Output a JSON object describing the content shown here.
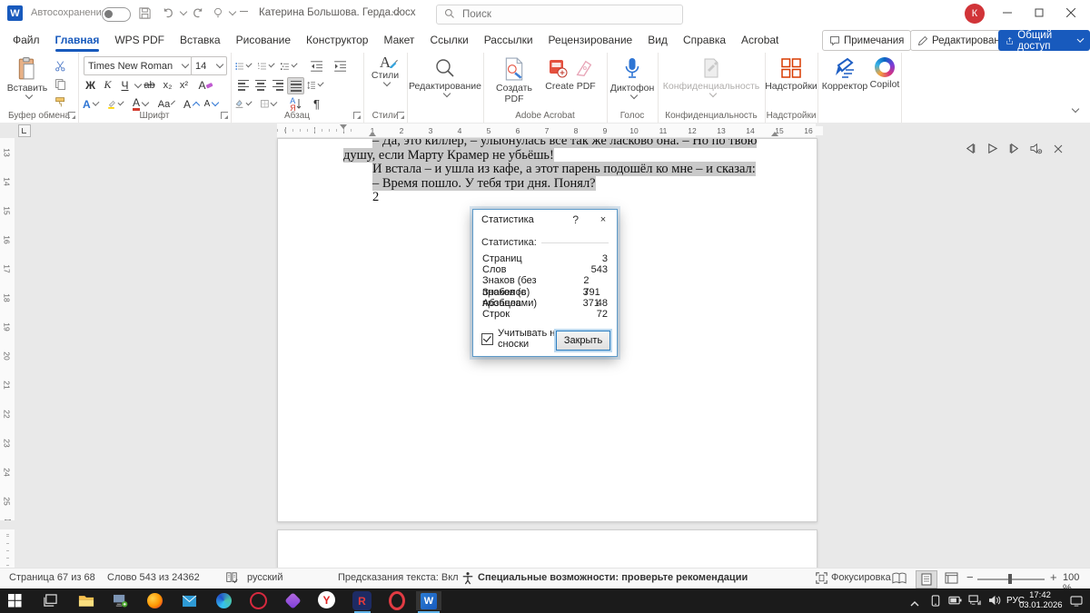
{
  "titlebar": {
    "app_logo": "W",
    "autosave_label": "Автосохранение",
    "doc_title": "Катерина Большова. Герда.docx",
    "search_placeholder": "Поиск",
    "avatar_initial": "К"
  },
  "tabs": [
    "Файл",
    "Главная",
    "WPS PDF",
    "Вставка",
    "Рисование",
    "Конструктор",
    "Макет",
    "Ссылки",
    "Рассылки",
    "Рецензирование",
    "Вид",
    "Справка",
    "Acrobat"
  ],
  "header_actions": {
    "comments": "Примечания",
    "editing": "Редактирование",
    "share": "Общий доступ"
  },
  "ribbon": {
    "clipboard": {
      "paste": "Вставить",
      "group": "Буфер обмена"
    },
    "font": {
      "name": "Times New Roman",
      "size": "14",
      "bold": "Ж",
      "italic": "К",
      "underline": "Ч",
      "strikethrough": "ab",
      "subscript": "x₂",
      "superscript": "x²",
      "clear_format": "А",
      "text_effects": "А",
      "font_color": "А",
      "change_case": "Аа",
      "grow": "А",
      "shrink": "А",
      "group": "Шрифт"
    },
    "paragraph": {
      "group": "Абзац",
      "sort": "Я",
      "pilcrow": "¶"
    },
    "styles": {
      "label": "Стили",
      "group": "Стили",
      "glyph": "А"
    },
    "editing": {
      "label": "Редактирование"
    },
    "acrobat": {
      "create_pdf_ru": "Создать PDF",
      "create_pdf_en": "Create PDF",
      "group": "Adobe Acrobat"
    },
    "voice": {
      "dictate": "Диктофон",
      "group": "Голос"
    },
    "sensitivity": {
      "label": "Конфиденциальность",
      "group": "Конфиденциальность"
    },
    "addins": {
      "label": "Надстройки",
      "group": "Надстройки"
    },
    "editor": {
      "label": "Корректор"
    },
    "copilot": {
      "label": "Copilot"
    }
  },
  "ruler": {
    "h_numbers": [
      "1",
      "2",
      "3",
      "4",
      "5",
      "6",
      "7",
      "8",
      "9",
      "10",
      "11",
      "12",
      "13",
      "14",
      "15",
      "16"
    ],
    "v_numbers": [
      "13",
      "14",
      "15",
      "16",
      "17",
      "18",
      "19",
      "20",
      "21",
      "22",
      "23",
      "24",
      "25"
    ]
  },
  "document": {
    "line1": "– Да, это киллер, – улыбнулась все так же ласково она. – Но по твою",
    "line2": "душу, если Марту Крамер не убьёшь!",
    "line3": "И встала – и ушла из кафе, а этот парень подошёл ко мне – и сказал:",
    "line4": "– Время пошло. У тебя три дня. Понял?",
    "line5": "2"
  },
  "dialog": {
    "title": "Статистика",
    "help": "?",
    "close_x": "×",
    "section": "Статистика:",
    "rows": [
      {
        "label": "Страниц",
        "value": "3"
      },
      {
        "label": "Слов",
        "value": "543"
      },
      {
        "label": "Знаков (без пробелов)",
        "value": "2 791"
      },
      {
        "label": "Знаков (с пробелами)",
        "value": "3 371"
      },
      {
        "label": "Абзацев",
        "value": "48"
      },
      {
        "label": "Строк",
        "value": "72"
      }
    ],
    "checkbox_label": "Учитывать надписи и сноски",
    "close_button": "Закрыть"
  },
  "statusbar": {
    "page": "Страница 67 из 68",
    "words": "Слово 543 из 24362",
    "language": "русский",
    "predictions": "Предсказания текста: Вкл",
    "accessibility": "Специальные возможности: проверьте рекомендации",
    "focus": "Фокусировка",
    "zoom": "100 %"
  },
  "taskbar": {
    "lang": "РУС",
    "time": "17:42",
    "date": "03.01.2026",
    "glyphs": {
      "word": "W",
      "yandex": "Y",
      "rapp": "R"
    }
  }
}
